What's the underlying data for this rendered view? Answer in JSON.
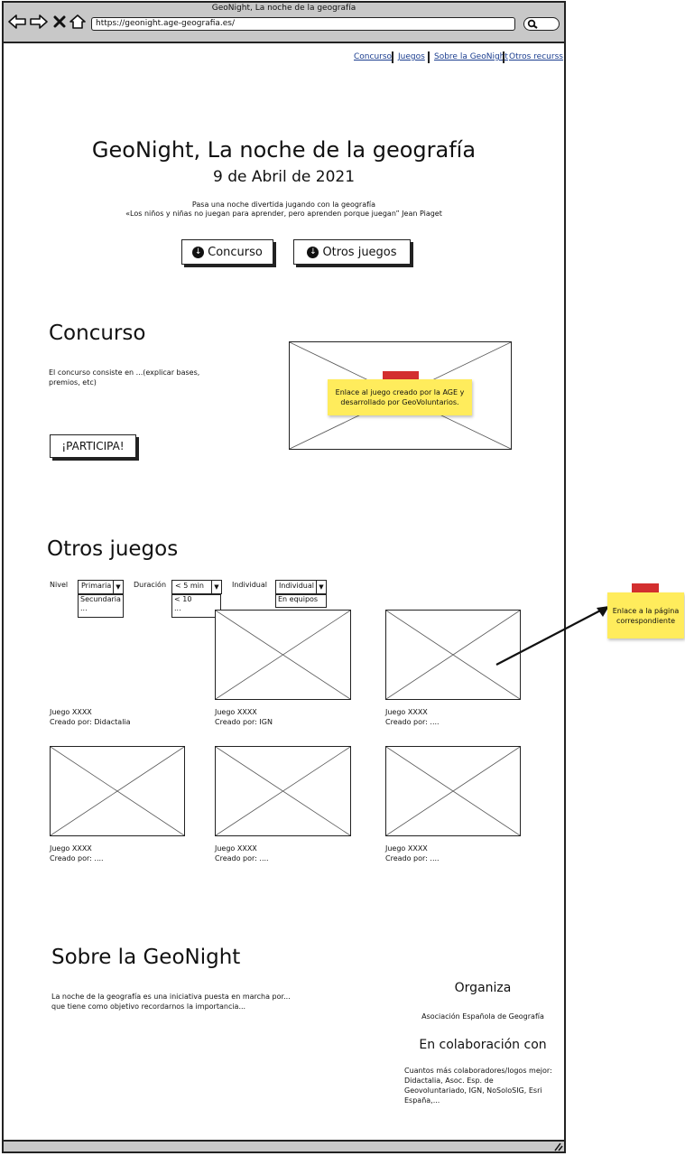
{
  "window": {
    "title": "GeoNight, La noche de la geografía",
    "url": "https://geonight.age-geografia.es/"
  },
  "nav": {
    "items": [
      "Concurso",
      "Juegos",
      "Sobre la GeoNight",
      "Otros recurss"
    ]
  },
  "hero": {
    "title": "GeoNight, La noche de la geografía",
    "date": "9 de Abril de 2021",
    "subtitle": "Pasa una noche divertida jugando con la geografía",
    "quote": "«Los niños y niñas no juegan para aprender, pero aprenden porque juegan” Jean Piaget",
    "buttons": [
      "Concurso",
      "Otros juegos"
    ]
  },
  "concurso": {
    "heading": "Concurso",
    "description": "El concurso consiste en ...(explicar bases, premios, etc)",
    "cta": "¡PARTICIPA!",
    "sticky": "Enlace al juego creado  por la AGE y desarrollado por GeoVoluntarios."
  },
  "otros": {
    "heading": "Otros juegos",
    "filters": {
      "nivel": {
        "label": "Nivel",
        "selected": "Primaria",
        "options": [
          "Secundaria",
          "..."
        ]
      },
      "duracion": {
        "label": "Duración",
        "selected": "< 5 min",
        "options": [
          "< 10",
          "..."
        ]
      },
      "individual": {
        "label": "Individual",
        "selected": "Individual",
        "options": [
          "En equipos"
        ]
      }
    },
    "games": [
      {
        "title": "Juego XXXX",
        "author": "Creado por: Didactalia"
      },
      {
        "title": "Juego XXXX",
        "author": "Creado por: IGN"
      },
      {
        "title": "Juego XXXX",
        "author": "Creado por: ...."
      },
      {
        "title": "Juego XXXX",
        "author": "Creado por: ...."
      },
      {
        "title": "Juego XXXX",
        "author": "Creado por: ...."
      },
      {
        "title": "Juego XXXX",
        "author": "Creado por: ...."
      }
    ],
    "note": "Enlace a la página correspondiente"
  },
  "sobre": {
    "heading": "Sobre la GeoNight",
    "text": "La noche de la geografía es una iniciativa puesta en marcha por... que tiene como objetivo recordarnos la importancia...",
    "organiza_heading": "Organiza",
    "organiza": "Asociación Española de Geografía",
    "colab_heading": "En colaboración con",
    "colab_text": "Cuantos más colaboradores/logos mejor: Didactalia, Asoc. Esp. de Geovoluntariado, IGN, NoSoloSIG, Esri España,..."
  },
  "colors": {
    "sticky": "#ffec5c",
    "tape": "#d32f2f",
    "link": "#1a3d8f",
    "chrome": "#c8c8c8"
  }
}
